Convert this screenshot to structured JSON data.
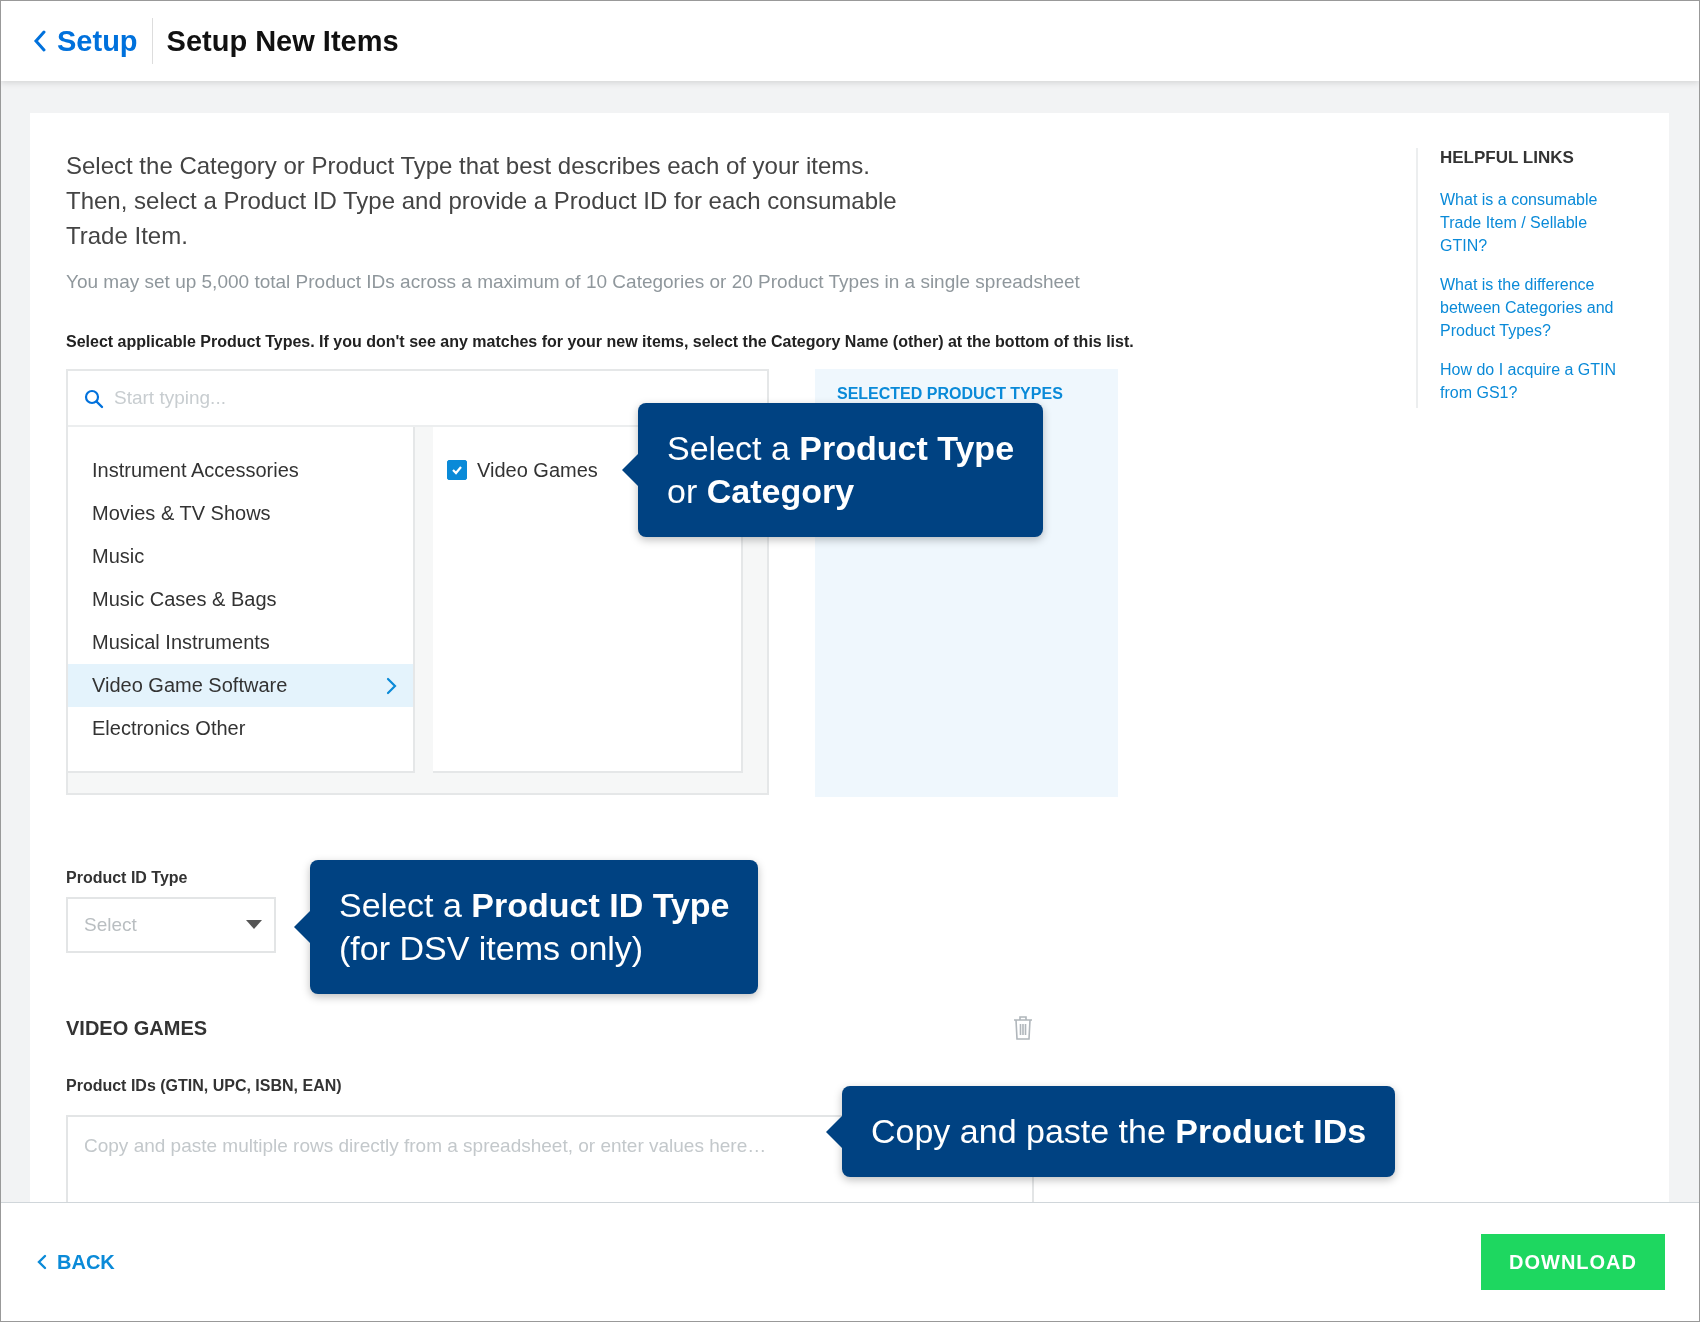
{
  "header": {
    "back_label": "Setup",
    "title": "Setup New Items"
  },
  "intro": [
    "Select the Category or Product Type that best describes each of your items.",
    "Then, select a Product ID Type and provide a Product ID for each consumable Trade Item."
  ],
  "note": "You may set up 5,000 total Product IDs across a maximum of 10 Categories or 20 Product Types in a single spreadsheet",
  "instruction": "Select applicable Product Types. If you don't see any matches for your new items, select the Category Name (other) at the bottom of this list.",
  "search": {
    "placeholder": "Start typing..."
  },
  "categories": [
    {
      "label": "Instrument Accessories",
      "selected": false
    },
    {
      "label": "Movies & TV Shows",
      "selected": false
    },
    {
      "label": "Music",
      "selected": false
    },
    {
      "label": "Music Cases & Bags",
      "selected": false
    },
    {
      "label": "Musical Instruments",
      "selected": false
    },
    {
      "label": "Video Game Software",
      "selected": true
    },
    {
      "label": "Electronics Other",
      "selected": false
    }
  ],
  "product_types": [
    {
      "label": "Video Games",
      "checked": true
    }
  ],
  "selected_panel": {
    "title": "SELECTED PRODUCT TYPES"
  },
  "product_id_type": {
    "label": "Product ID Type",
    "placeholder": "Select"
  },
  "section": {
    "title": "VIDEO GAMES",
    "ids_label": "Product IDs (GTIN, UPC, ISBN, EAN)",
    "ids_placeholder": "Copy and paste multiple rows directly from a spreadsheet, or enter values here…"
  },
  "helpful_links": {
    "title": "HELPFUL LINKS",
    "links": [
      "What is a consumable Trade Item / Sellable GTIN?",
      "What is the difference between Categories and Product Types?",
      "How do I acquire a GTIN from GS1?"
    ]
  },
  "callouts": [
    {
      "text": "Select a **Product Type**\nor **Category**"
    },
    {
      "text": "Select a **Product ID Type**\n(for DSV items only)"
    },
    {
      "text": "Copy and paste the **Product IDs**"
    }
  ],
  "footer": {
    "back": "BACK",
    "download": "DOWNLOAD"
  }
}
